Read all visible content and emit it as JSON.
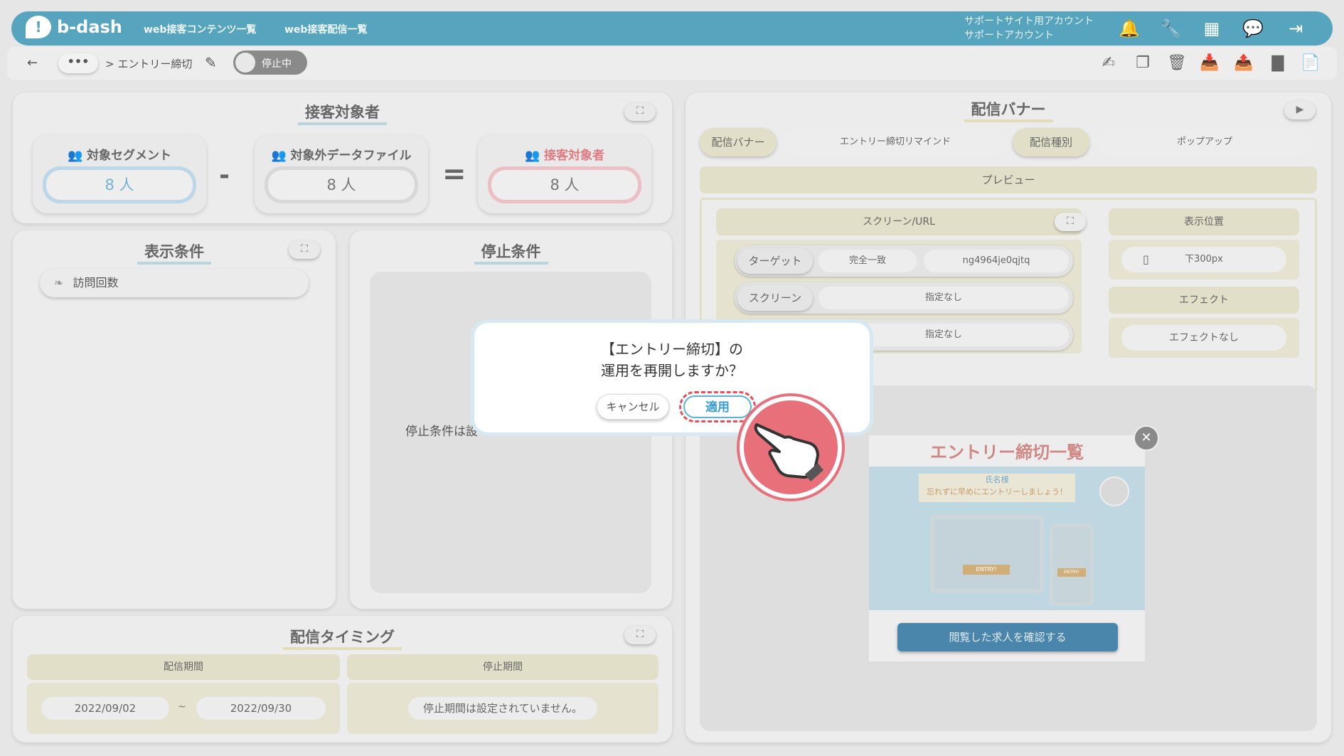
{
  "header": {
    "logo": "b-dash",
    "nav": [
      "web接客コンテンツ一覧",
      "web接客配信一覧"
    ],
    "account_line1": "サポートサイト用アカウント",
    "account_line2": "サポートアカウント",
    "icons": [
      "bell-icon",
      "wrench-icon",
      "grid-icon",
      "chat-icon",
      "logout-icon"
    ]
  },
  "subbar": {
    "back_icon": "←",
    "breadcrumb_more": "•••",
    "breadcrumb": "> エントリー締切",
    "status_toggle": "停止中"
  },
  "audience": {
    "title": "接客対象者",
    "segment_label": "対象セグメント",
    "segment_value": "8 人",
    "excluded_label": "対象外データファイル",
    "excluded_value": "8 人",
    "target_label": "接客対象者",
    "target_value": "8 人",
    "minus": "-",
    "equals": "="
  },
  "display_conditions": {
    "title": "表示条件",
    "item": "訪問回数"
  },
  "stop_conditions": {
    "title": "停止条件",
    "message": "停止条件は設"
  },
  "timing": {
    "title": "配信タイミング",
    "period_label": "配信期間",
    "stop_label": "停止期間",
    "start_date": "2022/09/02",
    "tilde": "~",
    "end_date": "2022/09/30",
    "stop_message": "停止期間は設定されていません。"
  },
  "banner": {
    "title": "配信バナー",
    "banner_label": "配信バナー",
    "banner_value": "エントリー締切リマインド",
    "type_label": "配信種別",
    "type_value": "ポップアップ",
    "preview": "プレビュー",
    "screen_url_title": "スクリーン/URL",
    "target_label": "ターゲット",
    "match": "完全一致",
    "target_value": "ng4964je0qjtq",
    "screen_label": "スクリーン",
    "screen_value": "指定なし",
    "extra_value": "指定なし",
    "position_title": "表示位置",
    "position_value": "下300px",
    "effect_title": "エフェクト",
    "effect_value": "エフェクトなし",
    "popup_title": "エントリー締切一覧",
    "popup_name": "氏名様",
    "popup_sub": "忘れずに早めにエントリーしましょう！",
    "popup_entry": "ENTRY!",
    "popup_button": "閲覧した求人を確認する",
    "close": "✕"
  },
  "dialog": {
    "line1": "【エントリー締切】の",
    "line2": "運用を再開しますか？",
    "cancel": "キャンセル",
    "apply": "適用"
  },
  "colors": {
    "header": "#57a4bf",
    "accent_red": "#e8505b",
    "accent_blue": "#5ab4d8",
    "popup_title": "#d9534f",
    "popup_button": "#3478a8"
  }
}
